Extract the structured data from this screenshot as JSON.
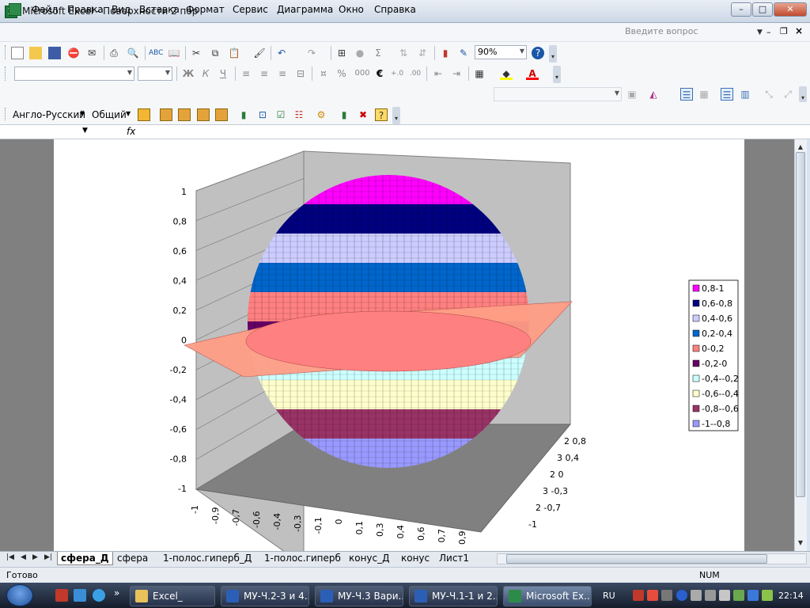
{
  "window": {
    "title": "Microsoft Excel - Поверхности 2 пор",
    "min": "–",
    "max": "□",
    "close": "✕"
  },
  "menu": {
    "items": [
      "Файл",
      "Правка",
      "Вид",
      "Вставка",
      "Формат",
      "Сервис",
      "Диаграмма",
      "Окно",
      "Справка"
    ],
    "help_placeholder": "Введите вопрос"
  },
  "toolbar": {
    "zoom": "90%",
    "sigma": "Σ",
    "euro": "€",
    "percent": "%",
    "thousands": "000",
    "format_buttons": [
      "Ж",
      "К",
      "Ч"
    ]
  },
  "toolbar3": {
    "translate": "Англо-Русский",
    "general": "Общий"
  },
  "formula_bar": {
    "fx": "fx"
  },
  "chart_data": {
    "type": "surface",
    "zticks": [
      "1",
      "0,8",
      "0,6",
      "0,4",
      "0,2",
      "0",
      "-0,2",
      "-0,4",
      "-0,6",
      "-0,8",
      "-1"
    ],
    "xticks": [
      "-1",
      "-0,9",
      "-0,7",
      "-0,6",
      "-0,4",
      "-0,3",
      "-0,1",
      "0",
      "0,1",
      "0,3",
      "0,4",
      "0,6",
      "0,7",
      "0,9"
    ],
    "yticks": [
      "2 0,8",
      "3 0,4",
      "2 0",
      "3 -0,3",
      "2 -0,7",
      "-1"
    ],
    "legend": [
      {
        "label": "0,8-1",
        "color": "#ff00ff"
      },
      {
        "label": "0,6-0,8",
        "color": "#000080"
      },
      {
        "label": "0,4-0,6",
        "color": "#ccccff"
      },
      {
        "label": "0,2-0,4",
        "color": "#0066cc"
      },
      {
        "label": "0-0,2",
        "color": "#ff8080"
      },
      {
        "label": "-0,2-0",
        "color": "#660066"
      },
      {
        "label": "-0,4--0,2",
        "color": "#ccffff"
      },
      {
        "label": "-0,6--0,4",
        "color": "#ffffcc"
      },
      {
        "label": "-0,8--0,6",
        "color": "#993366"
      },
      {
        "label": "-1--0,8",
        "color": "#9999ff"
      }
    ],
    "legend_position": "right"
  },
  "sheets": {
    "tabs": [
      "сфера_Д",
      "сфера",
      "1-полос.гиперб_Д",
      "1-полос.гиперб",
      "конус_Д",
      "конус",
      "Лист1"
    ],
    "active": "сфера_Д"
  },
  "status": {
    "text": "Готово",
    "num": "NUM"
  },
  "taskbar": {
    "tasks": [
      "Excel_",
      "МУ-Ч.2-3 и 4...",
      "МУ-Ч.3 Вари...",
      "МУ-Ч.1-1 и 2...",
      "Microsoft Ex..."
    ],
    "lang": "RU",
    "clock": "22:14",
    "more": "»"
  }
}
